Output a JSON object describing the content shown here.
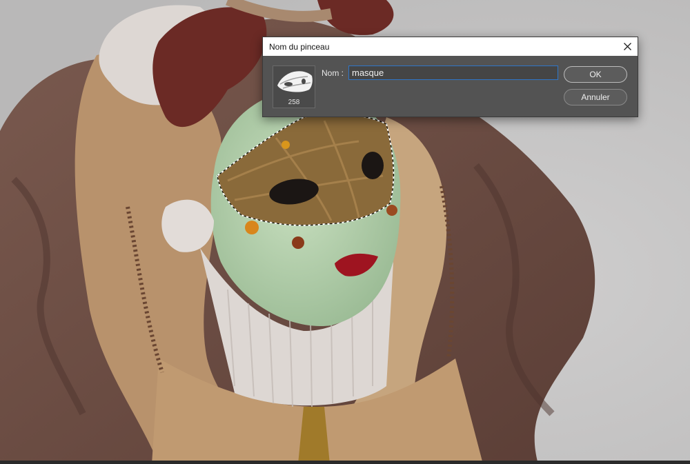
{
  "dialog": {
    "title": "Nom du pinceau",
    "close_icon": "close-icon",
    "preview_icon": "mask-brush-tip-icon",
    "brush_size": "258",
    "name_label": "Nom :",
    "name_value": "masque",
    "ok_label": "OK",
    "cancel_label": "Annuler"
  },
  "background": {
    "description_icon": "venetian-mask-photo",
    "colors": {
      "backdrop": "#c9c8c8",
      "cloak": "#6e4d43",
      "mask_face": "#b8d3b0",
      "mask_lace": "#8a6a3a",
      "lips": "#9e1420",
      "fabric_light": "#c6a57e",
      "ruffle_white": "#ddd7d3",
      "burgundy": "#6b2a25"
    }
  }
}
